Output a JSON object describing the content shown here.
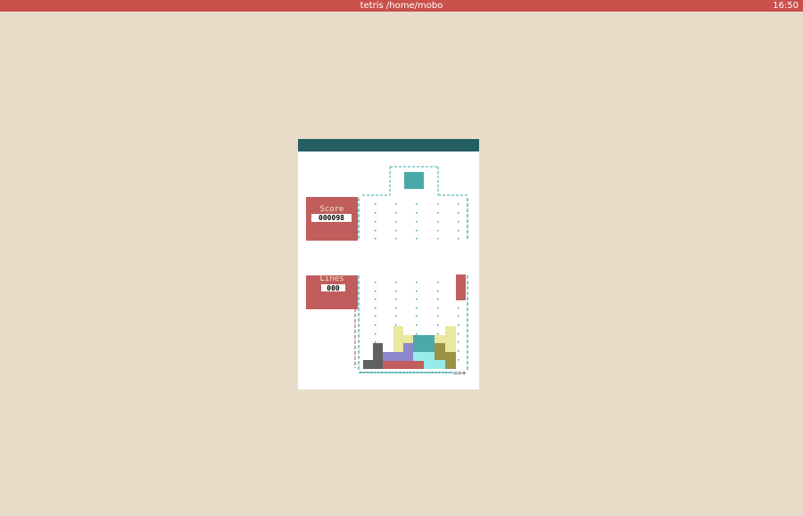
{
  "topbar": {
    "title": "tetris  /home/mobo",
    "clock": "16:50"
  },
  "game": {
    "score_label": "Score",
    "score_value": "000098",
    "lines_label": "Lines",
    "lines_value": "000"
  },
  "colors": {
    "background": "#e8dcc9",
    "topbar": "#c9504b",
    "window_titlebar": "#245e63",
    "panel": "#c15d5d",
    "grid_dots": "#3aa5a5",
    "next_piece": "#4aa9a9"
  },
  "next_piece": {
    "shape": "O",
    "color": "#4aa9a9"
  },
  "falling_piece": {
    "shape": "I",
    "color": "#c15d5d"
  },
  "stack_blocks": [
    {
      "color": "#606060",
      "name": "dark-gray-block"
    },
    {
      "color": "#8b87cc",
      "name": "purple-block"
    },
    {
      "color": "#c15d5d",
      "name": "red-block"
    },
    {
      "color": "#eae79e",
      "name": "yellow-block"
    },
    {
      "color": "#4aa9a9",
      "name": "teal-block"
    },
    {
      "color": "#97ebeb",
      "name": "cyan-block"
    },
    {
      "color": "#9a9346",
      "name": "olive-block"
    }
  ]
}
